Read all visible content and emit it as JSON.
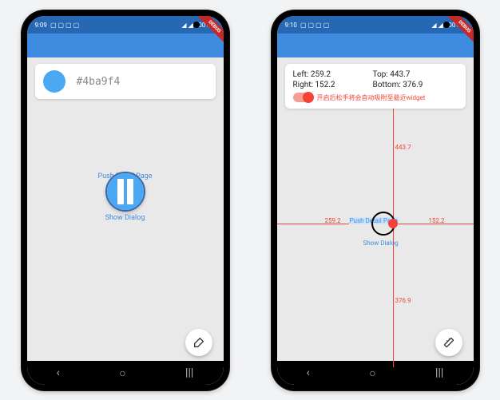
{
  "status": {
    "time_left": "9:09",
    "time_right": "9:10",
    "battery": "100%",
    "icons": "▢ ▢ ▢ ▢"
  },
  "debug_label": "DEBUG",
  "left_phone": {
    "hex": "#4ba9f4",
    "push_text": "Push Detail Page",
    "show_dialog": "Show Dialog"
  },
  "right_phone": {
    "left_label": "Left:",
    "left_val": "259.2",
    "top_label": "Top:",
    "top_val": "443.7",
    "right_label": "Right:",
    "right_val": "152.2",
    "bottom_label": "Bottom:",
    "bottom_val": "376.9",
    "toggle_text": "开启后松手将会自动吸附至最近widget",
    "push_text": "Push Detail Page",
    "show_dialog": "Show Dialog",
    "measure_top": "443.7",
    "measure_left": "259.2",
    "measure_right": "152.2",
    "measure_bottom": "376.9"
  }
}
